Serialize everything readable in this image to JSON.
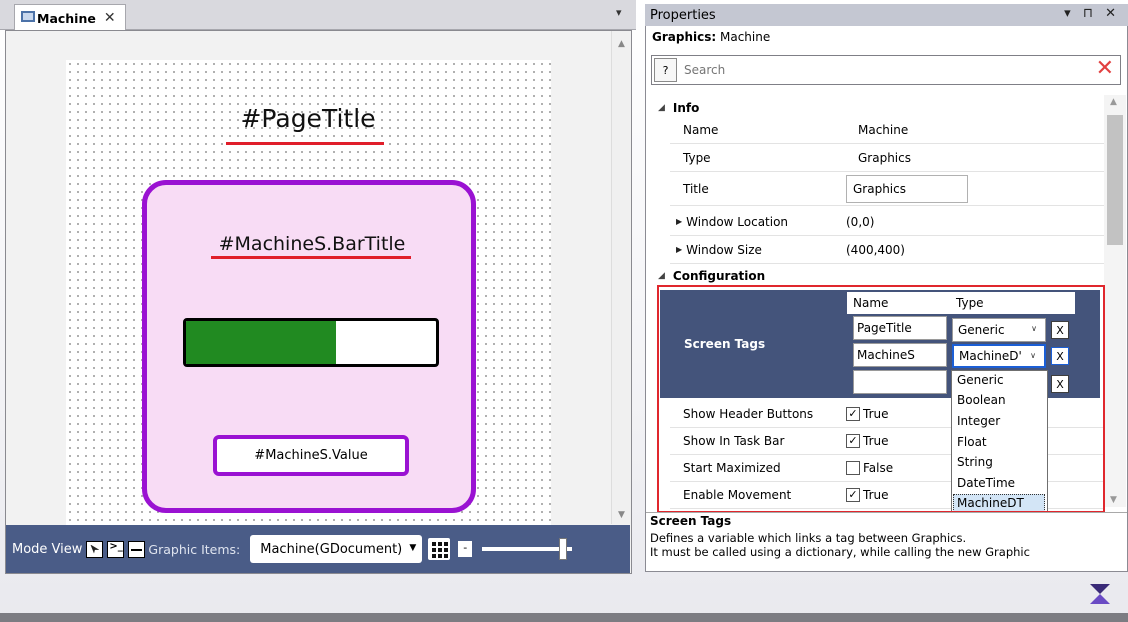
{
  "document_tab": {
    "title": "Machine",
    "close_glyph": "✕"
  },
  "tab_menu_glyph": "▾",
  "canvas": {
    "page_title": "#PageTitle",
    "bar_title": "#MachineS.BarTitle",
    "progress_fraction": 0.6,
    "value_text": "#MachineS.Value",
    "colors": {
      "card_border": "#9a12d2",
      "card_fill": "#f8dcf5",
      "underline": "#e01e2a",
      "progress": "#218a21"
    }
  },
  "mode_bar": {
    "mode_view_label": "Mode View",
    "graphic_items_label": "Graphic Items:",
    "graphic_items_value": "Machine(GDocument)",
    "zoom_minus": "-",
    "zoom_level": 0.9
  },
  "properties": {
    "header": "Properties",
    "header_controls": "▾ ⊓ ✕",
    "graphics_label": "Graphics:",
    "graphics_name": "Machine",
    "help_label": "?",
    "search_placeholder": "Search",
    "clear_glyph": "✕",
    "info": {
      "label": "Info",
      "rows": [
        {
          "name": "Name",
          "value": "Machine"
        },
        {
          "name": "Type",
          "value": "Graphics"
        },
        {
          "name": "Title",
          "value": "Graphics"
        },
        {
          "name": "Window Location",
          "value": "(0,0)"
        },
        {
          "name": "Window Size",
          "value": "(400,400)"
        }
      ]
    },
    "configuration": {
      "label": "Configuration",
      "screen_tags": {
        "label": "Screen Tags",
        "col_name": "Name",
        "col_type": "Type",
        "rows": [
          {
            "name": "PageTitle",
            "type": "Generic"
          },
          {
            "name": "MachineS",
            "type": "MachineD'"
          },
          {
            "name": "",
            "type": ""
          }
        ],
        "remove_label": "X",
        "type_options": [
          "Generic",
          "Boolean",
          "Integer",
          "Float",
          "String",
          "DateTime",
          "MachineDT"
        ],
        "selected_option": "MachineDT"
      },
      "rows": [
        {
          "name": "Show Header Buttons",
          "checked": true,
          "value": "True"
        },
        {
          "name": "Show In Task Bar",
          "checked": true,
          "value": "True"
        },
        {
          "name": "Start Maximized",
          "checked": false,
          "value": "False"
        },
        {
          "name": "Enable Movement",
          "checked": true,
          "value": "True"
        }
      ]
    },
    "description": {
      "title": "Screen Tags",
      "line1": "Defines a variable which links a tag between Graphics.",
      "line2": "It must be called using a dictionary, while calling the new Graphic"
    }
  }
}
